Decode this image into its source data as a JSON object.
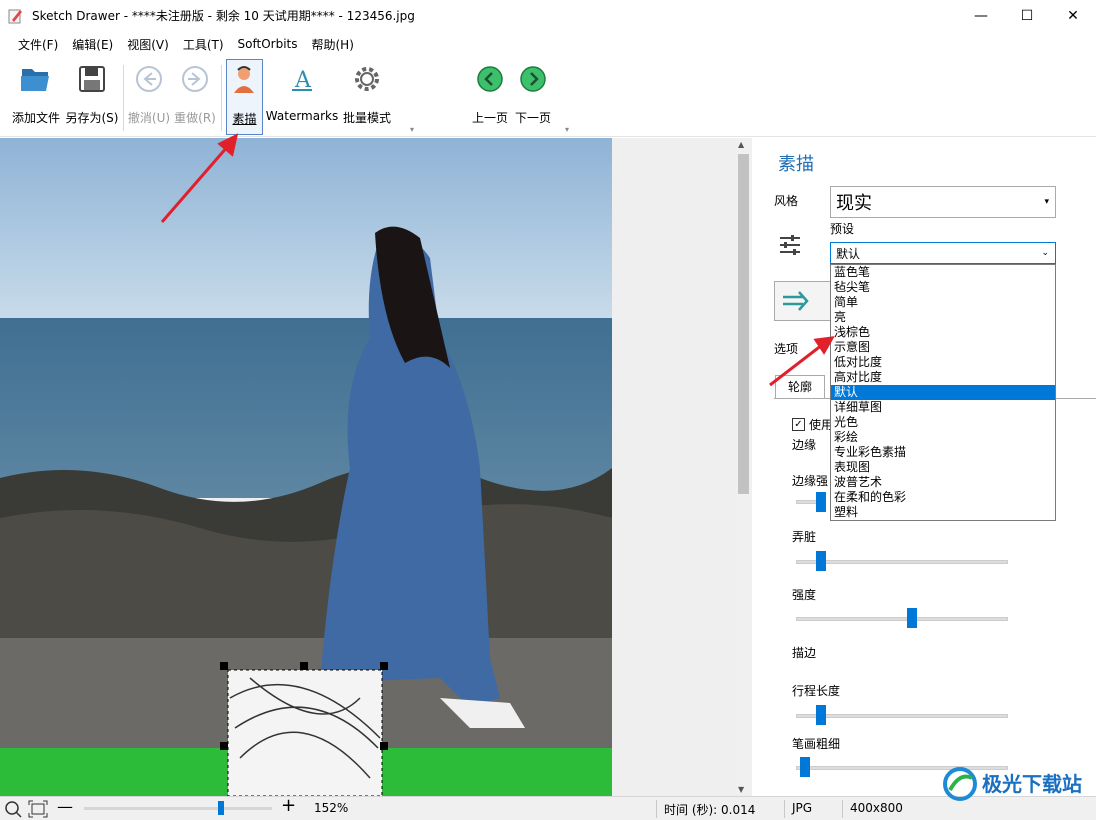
{
  "window": {
    "title": "Sketch Drawer - ****未注册版 - 剩余 10 天试用期**** - 123456.jpg",
    "minimize": "—",
    "maximize": "☐",
    "close": "✕"
  },
  "menu": [
    "文件(F)",
    "编辑(E)",
    "视图(V)",
    "工具(T)",
    "SoftOrbits",
    "帮助(H)"
  ],
  "toolbar": {
    "add_file": "添加文件",
    "save_as": "另存为(S)",
    "undo": "撤消(U)",
    "redo": "重做(R)",
    "sketch": "素描",
    "watermarks": "Watermarks",
    "batch": "批量模式",
    "prev": "上一页",
    "next": "下一页"
  },
  "panel": {
    "title": "素描",
    "style_label": "风格",
    "style_value": "现实",
    "preset_label": "预设",
    "preset_value": "默认",
    "options_label": "选项",
    "tab_outline": "轮廓",
    "use_label": "使用",
    "edges_label": "边缘",
    "edge_strength_label": "边缘强",
    "smudge_label": "弄脏",
    "intensity_label": "强度",
    "stroke_label": "描边",
    "stroke_length_label": "行程长度",
    "stroke_width_label": "笔画粗细",
    "sliders": {
      "smudge": 0.1,
      "intensity": 0.55,
      "stroke_length": 0.1,
      "stroke_width": 0.02
    }
  },
  "preset_options": [
    "蓝色笔",
    "毡尖笔",
    "简单",
    "亮",
    "浅棕色",
    "示意图",
    "低对比度",
    "高对比度",
    "默认",
    "详细草图",
    "光色",
    "彩绘",
    "专业彩色素描",
    "表现图",
    "波普艺术",
    "在柔和的色彩",
    "塑料"
  ],
  "preset_selected_index": 8,
  "status": {
    "zoom": "152%",
    "time": "时间 (秒): 0.014",
    "format": "JPG",
    "dimensions": "400x800"
  },
  "watermark_text": "极光下载站",
  "colors": {
    "accent": "#0078d7",
    "title_blue": "#1f6fb5",
    "arrow_red": "#e0202a",
    "green_band": "#2dbb3a"
  }
}
